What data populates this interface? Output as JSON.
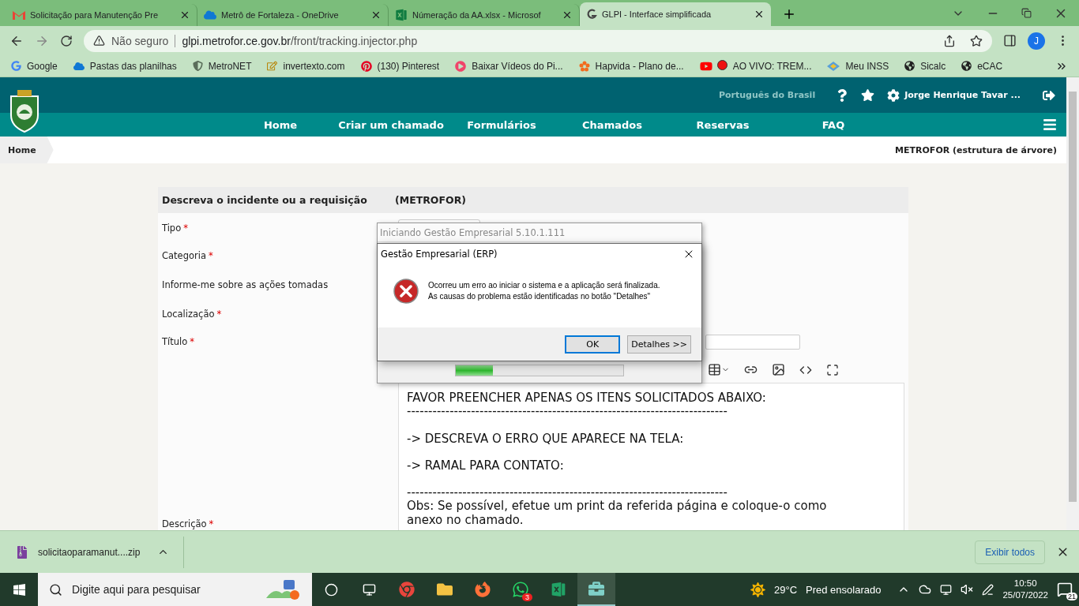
{
  "browser": {
    "tabs": [
      {
        "kind": "gmail",
        "title": "Solicitação para Manutenção Pre",
        "selected": false
      },
      {
        "kind": "onedrive",
        "title": "Metrô de Fortaleza - OneDrive",
        "selected": false
      },
      {
        "kind": "excel",
        "title": "Númeração da AA.xlsx - Microsof",
        "selected": false
      },
      {
        "kind": "glpi",
        "title": "GLPI - Interface simplificada",
        "selected": true
      }
    ],
    "security": "Não seguro",
    "url_host": "glpi.metrofor.ce.gov.br",
    "url_path": "/front/tracking.injector.php",
    "profile_initial": "J",
    "bookmarks": [
      {
        "kind": "google",
        "label": "Google"
      },
      {
        "kind": "cloud",
        "label": "Pastas das planilhas"
      },
      {
        "kind": "emblem",
        "label": "MetroNET"
      },
      {
        "kind": "notepad",
        "label": "invertexto.com"
      },
      {
        "kind": "pinterest",
        "label": "(130) Pinterest"
      },
      {
        "kind": "play",
        "label": "Baixar Vídeos do Pi..."
      },
      {
        "kind": "flower",
        "label": "Hapvida - Plano de..."
      },
      {
        "kind": "youtube",
        "label": "AO VIVO: TREM..."
      },
      {
        "kind": "inss",
        "label": "Meu INSS"
      },
      {
        "kind": "globe",
        "label": "Sicalc"
      },
      {
        "kind": "globe",
        "label": "eCAC"
      }
    ]
  },
  "glpi": {
    "language": "Português do Brasil",
    "user": "Jorge Henrique Tavar ...",
    "nav": [
      "Home",
      "Criar um chamado",
      "Formulários",
      "Chamados",
      "Reservas",
      "FAQ"
    ],
    "breadcrumb": "Home",
    "entity_scope": "METROFOR (estrutura de árvore)",
    "form": {
      "title": "Descreva o incidente ou a requisição",
      "entity": "(METROFOR)",
      "required_mark": "*",
      "fields": [
        {
          "kind": "select",
          "label": "Tipo",
          "required": true
        },
        {
          "kind": "plain",
          "label": "Categoria",
          "required": true
        },
        {
          "kind": "tall",
          "label": "Informe-me sobre as ações tomadas",
          "required": false
        },
        {
          "kind": "plain",
          "label": "Localização",
          "required": true
        },
        {
          "kind": "input",
          "label": "Título",
          "required": true
        },
        {
          "kind": "editor",
          "label": "Descrição",
          "required": true
        }
      ],
      "editor_blocks": [
        [
          "FAVOR PREENCHER APENAS OS ITENS SOLICITADOS ABAIXO:",
          "---------------------------------------------------------------------------"
        ],
        [
          "-> DESCREVA O ERRO QUE APARECE NA TELA:"
        ],
        [
          "-> RAMAL PARA CONTATO:"
        ],
        [
          "---------------------------------------------------------------------------",
          "Obs: Se possível, efetue um print da referida página e coloque-o como anexo no chamado."
        ]
      ]
    }
  },
  "loader_window": {
    "title": "Iniciando Gestão Empresarial 5.10.1.111",
    "level": 0.22
  },
  "error_dialog": {
    "title": "Gestão Empresarial (ERP)",
    "message": [
      "Ocorreu um erro ao iniciar o sistema e a aplicação será finalizada.",
      "As causas do problema estão identificadas no botão \"Detalhes\""
    ],
    "buttons": [
      {
        "label": "OK",
        "selected": true
      },
      {
        "label": "Detalhes >>",
        "selected": false
      }
    ]
  },
  "downloads": {
    "file": "solicitaoparamanut....zip",
    "show_all": "Exibir todos"
  },
  "taskbar": {
    "search_placeholder": "Digite aqui para pesquisar",
    "apps": [
      {
        "kind": "chrome",
        "selected": false
      },
      {
        "kind": "folder",
        "selected": false
      },
      {
        "kind": "firefox",
        "selected": false
      },
      {
        "kind": "whatsapp",
        "selected": false,
        "badge": "3"
      },
      {
        "kind": "excel",
        "selected": false
      },
      {
        "kind": "briefcase",
        "selected": true
      }
    ],
    "temperature": "29°C",
    "weather": "Pred ensolarado",
    "time": "10:50",
    "date": "25/07/2022",
    "notifications": "21"
  }
}
